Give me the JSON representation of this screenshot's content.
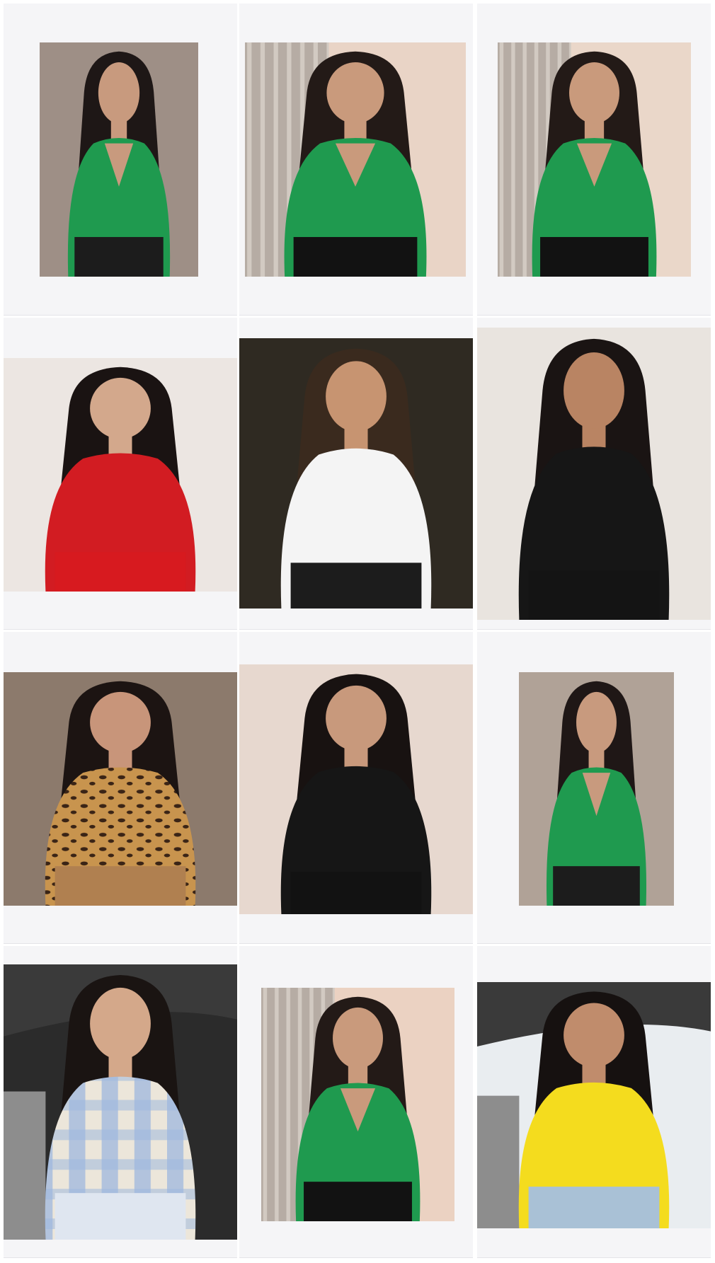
{
  "gallery": {
    "page_background": "#ffffff",
    "cell_background": "#f5f5f7",
    "photos": [
      {
        "name": "photo-1-green-bodysuit-closeup",
        "top": "green",
        "wall": "#9e8f86",
        "hair": "#1e1716",
        "skin": "#c89a7e",
        "bottom": "#1c1c1c"
      },
      {
        "name": "photo-2-green-bodysuit-curtain",
        "top": "green",
        "wall": "#e9d4c6",
        "hair": "#231a17",
        "skin": "#c99a7c",
        "bottom": "#121212"
      },
      {
        "name": "photo-3-green-bodysuit-curtain",
        "top": "green",
        "wall": "#ead7c9",
        "hair": "#231a17",
        "skin": "#c99a7c",
        "bottom": "#121212"
      },
      {
        "name": "photo-4-red-satin-top",
        "top": "red",
        "wall": "#ece6e2",
        "hair": "#1a1312",
        "skin": "#d3a88c",
        "bottom": "#d71a1f"
      },
      {
        "name": "photo-5-white-tee",
        "top": "white",
        "wall": "#2f2a22",
        "hair": "#3a2a1e",
        "skin": "#c79471",
        "bottom": "#1c1c1c"
      },
      {
        "name": "photo-6-black-cutout-top",
        "top": "black",
        "wall": "#e9e4df",
        "hair": "#1a1413",
        "skin": "#b98463",
        "bottom": "#141414"
      },
      {
        "name": "photo-7-leopard-blouse",
        "top": "leopard",
        "wall": "#8c7a6c",
        "hair": "#1c1412",
        "skin": "#c8957a",
        "bottom": "#b08050"
      },
      {
        "name": "photo-8-black-one-shoulder",
        "top": "black",
        "wall": "#e7d8cf",
        "hair": "#181211",
        "skin": "#c8997c",
        "bottom": "#121212"
      },
      {
        "name": "photo-9-green-bodysuit-standing",
        "top": "green",
        "wall": "#b0a297",
        "hair": "#1f1716",
        "skin": "#c89a7e",
        "bottom": "#1c1c1c"
      },
      {
        "name": "photo-10-plaid-jacket-car",
        "top": "plaid",
        "wall": "#2b2b2b",
        "hair": "#1a1412",
        "skin": "#d4a88a",
        "bottom": "#dfe6f0"
      },
      {
        "name": "photo-11-green-bodysuit-hand-hip",
        "top": "green",
        "wall": "#ebd2c2",
        "hair": "#231a17",
        "skin": "#c99a7c",
        "bottom": "#121212"
      },
      {
        "name": "photo-12-yellow-blouse-car",
        "top": "yellow",
        "wall": "#e9edf0",
        "hair": "#161110",
        "skin": "#c08c6c",
        "bottom": "#a9c1d6"
      }
    ]
  }
}
